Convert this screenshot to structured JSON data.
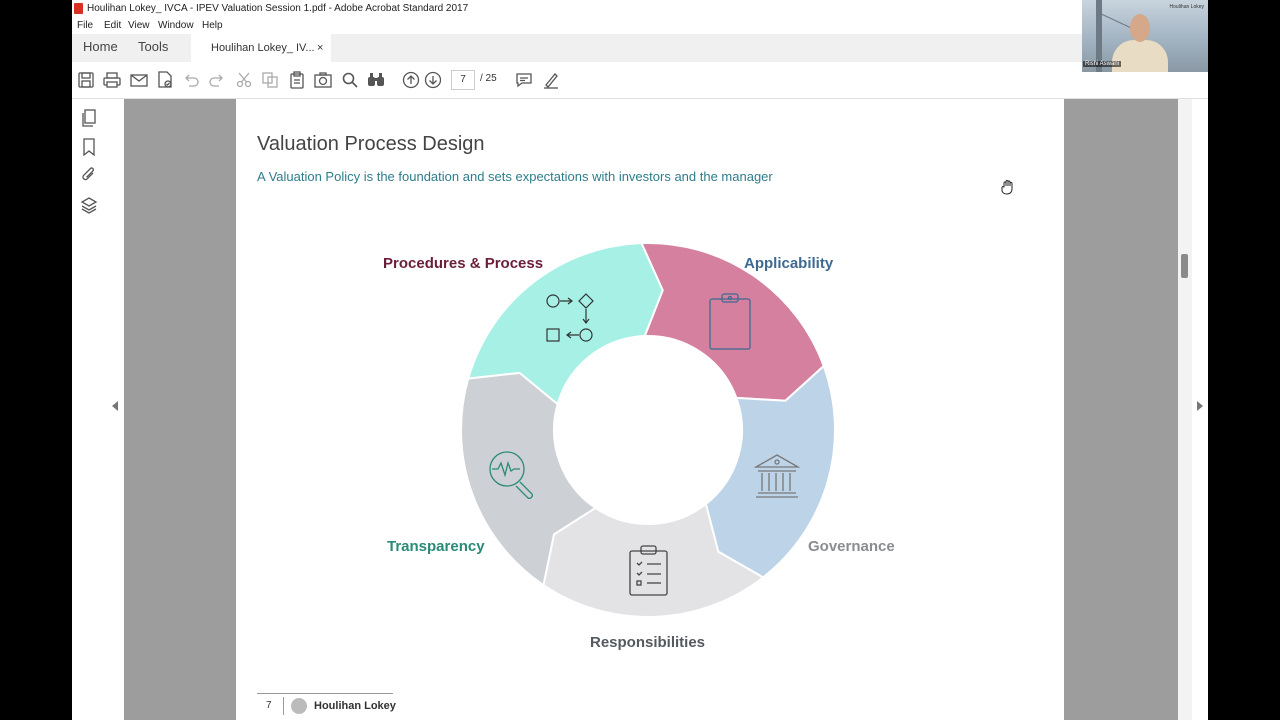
{
  "window": {
    "title": "Houlihan Lokey_ IVCA - IPEV Valuation Session 1.pdf - Adobe Acrobat Standard 2017"
  },
  "menu": [
    "File",
    "Edit",
    "View",
    "Window",
    "Help"
  ],
  "tabs": {
    "home": "Home",
    "tools": "Tools",
    "document": "Houlihan Lokey_ IV...",
    "close": "×"
  },
  "toolbar": {
    "icons": [
      "save-icon",
      "print-icon",
      "email-icon",
      "sign-icon",
      "undo-icon",
      "redo-icon",
      "cut-icon",
      "copy-icon",
      "paste-icon",
      "snapshot-icon",
      "search-icon",
      "find-icon",
      "prev-page-icon",
      "next-page-icon",
      "comment-icon",
      "highlight-icon"
    ],
    "page_current": "7",
    "page_total": "/ 25"
  },
  "sidebar": {
    "icons": [
      "pages-icon",
      "bookmark-icon",
      "attachment-icon",
      "layers-icon"
    ]
  },
  "slide": {
    "title": "Valuation Process Design",
    "subtitle": "A Valuation Policy is the foundation and sets expectations with investors and the manager",
    "segments": [
      {
        "label": "Procedures & Process",
        "color": "#d6809f",
        "label_color": "#6b1e3a",
        "icon": "flowchart-icon"
      },
      {
        "label": "Applicability",
        "color": "#bdd3e8",
        "label_color": "#3e6a91",
        "icon": "clipboard-icon"
      },
      {
        "label": "Governance",
        "color": "#e3e3e5",
        "label_color": "#8a8d91",
        "icon": "bank-icon"
      },
      {
        "label": "Responsibilities",
        "color": "#cdd0d4",
        "label_color": "#555a60",
        "icon": "checklist-icon"
      },
      {
        "label": "Transparency",
        "color": "#a6f0e6",
        "label_color": "#2b8a78",
        "icon": "magnifier-pulse-icon"
      }
    ],
    "footer": {
      "page_number": "7",
      "brand": "Houlihan Lokey"
    }
  },
  "webcam": {
    "name": "Rishi Aswani",
    "brand": "Houlihan Lokey"
  }
}
